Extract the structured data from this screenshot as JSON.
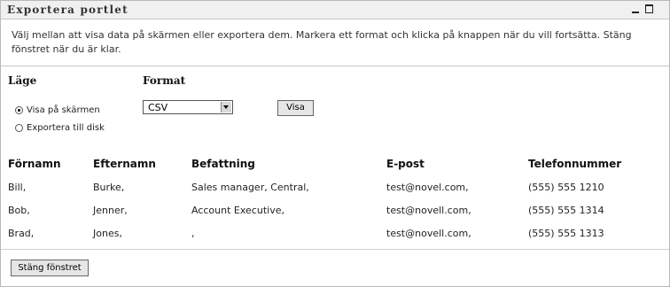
{
  "portlet": {
    "title": "Exportera portlet",
    "minimize_icon": "minimize-icon",
    "maximize_icon": "maximize-icon"
  },
  "intro_text": "Välj mellan att visa data på skärmen eller exportera dem. Markera ett format och klicka på knappen när du vill fortsätta. Stäng fönstret när du är klar.",
  "mode": {
    "label": "Läge",
    "options": [
      {
        "label": "Visa på skärmen",
        "selected": true
      },
      {
        "label": "Exportera till disk",
        "selected": false
      }
    ]
  },
  "format": {
    "label": "Format",
    "selected_value": "CSV"
  },
  "buttons": {
    "show": "Visa",
    "close": "Stäng fönstret"
  },
  "table": {
    "headers": [
      "Förnamn",
      "Efternamn",
      "Befattning",
      "E-post",
      "Telefonnummer"
    ],
    "rows": [
      [
        "Bill,",
        "Burke,",
        "Sales manager, Central,",
        "test@novel.com,",
        "(555) 555 1210"
      ],
      [
        "Bob,",
        "Jenner,",
        "Account Executive,",
        "test@novell.com,",
        "(555) 555 1314"
      ],
      [
        "Brad,",
        "Jones,",
        ",",
        "test@novell.com,",
        "(555) 555 1313"
      ]
    ]
  }
}
